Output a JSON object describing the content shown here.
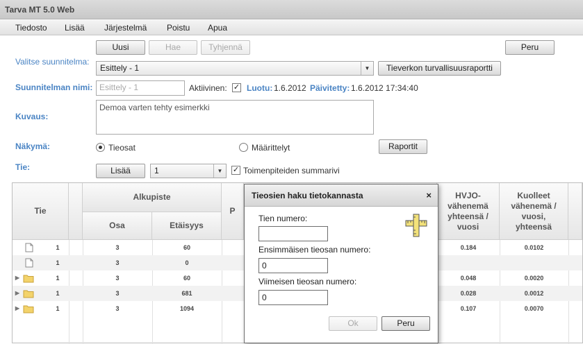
{
  "app": {
    "title": "Tarva MT 5.0 Web"
  },
  "menu": [
    "Tiedosto",
    "Lisää",
    "Järjestelmä",
    "Poistu",
    "Apua"
  ],
  "toolbar": {
    "new": "Uusi",
    "search": "Hae",
    "clear": "Tyhjennä",
    "cancel": "Peru"
  },
  "plan": {
    "select_label": "Valitse suunnitelma:",
    "selected": "Esittely - 1",
    "safety_report_button": "Tieverkon turvallisuusraportti",
    "name_label": "Suunnitelman nimi:",
    "name_value": "Esittely - 1",
    "active_label": "Aktiivinen:",
    "active_checked": "✓",
    "created_label": "Luotu:",
    "created_value": "1.6.2012",
    "updated_label": "Päivitetty:",
    "updated_value": "1.6.2012 17:34:40",
    "description_label": "Kuvaus:",
    "description_value": "Demoa varten tehty esimerkki"
  },
  "view": {
    "label": "Näkymä:",
    "option_roads": "Tieosat",
    "option_definitions": "Määrittelyt",
    "report_button": "Raportit"
  },
  "road": {
    "label": "Tie:",
    "add_button": "Lisää",
    "selected": "1",
    "summary_checkbox": "✓",
    "summary_label": "Toimenpiteiden summarivi"
  },
  "grid": {
    "headers": {
      "tie": "Tie",
      "start": "Alkupiste",
      "section": "Osa",
      "distance": "Etäisyys",
      "partial": "P",
      "hvjo": "HVJO-vähenemä yhteensä / vuosi",
      "deaths": "Kuolleet vähenemä / vuosi, yhteensä"
    },
    "rows": [
      {
        "tie": "1",
        "osa": "3",
        "etaisyys": "60",
        "hvjo": "0.184",
        "kuolleet": "0.0102",
        "icon": "file-icon"
      },
      {
        "tie": "1",
        "osa": "3",
        "etaisyys": "0",
        "hvjo": "",
        "kuolleet": "",
        "icon": "file-icon"
      },
      {
        "tie": "1",
        "osa": "3",
        "etaisyys": "60",
        "hvjo": "0.048",
        "kuolleet": "0.0020",
        "icon": "folder-icon"
      },
      {
        "tie": "1",
        "osa": "3",
        "etaisyys": "681",
        "hvjo": "0.028",
        "kuolleet": "0.0012",
        "icon": "folder-icon"
      },
      {
        "tie": "1",
        "osa": "3",
        "etaisyys": "1094",
        "hvjo": "0.107",
        "kuolleet": "0.0070",
        "icon": "folder-icon"
      }
    ]
  },
  "dialog": {
    "title": "Tieosien haku tietokannasta",
    "close": "×",
    "road_number_label": "Tien numero:",
    "road_number_value": "",
    "first_section_label": "Ensimmäisen tieosan numero:",
    "first_section_value": "0",
    "last_section_label": "Viimeisen tieosan numero:",
    "last_section_value": "0",
    "ok": "Ok",
    "cancel": "Peru"
  },
  "colors": {
    "label_blue": "#4a84c4",
    "folder_yellow": "#f3d36b"
  }
}
